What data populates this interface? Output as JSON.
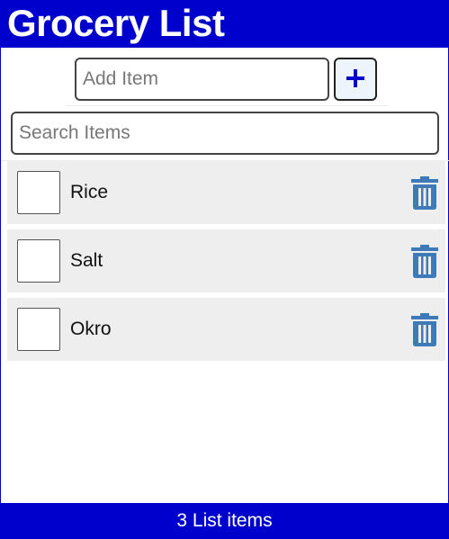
{
  "header": {
    "title": "Grocery List"
  },
  "add_item": {
    "placeholder": "Add Item",
    "button_icon": "plus-icon"
  },
  "search": {
    "placeholder": "Search Items"
  },
  "items": [
    {
      "label": "Rice",
      "checked": false,
      "delete_icon": "trash-icon"
    },
    {
      "label": "Salt",
      "checked": false,
      "delete_icon": "trash-icon"
    },
    {
      "label": "Okro",
      "checked": false,
      "delete_icon": "trash-icon"
    }
  ],
  "footer": {
    "count_text": "3 List items"
  },
  "colors": {
    "brand": "#0000cc",
    "item_bg": "#eeeeee",
    "trash": "#3f7ab8",
    "plus": "#0000cc"
  }
}
